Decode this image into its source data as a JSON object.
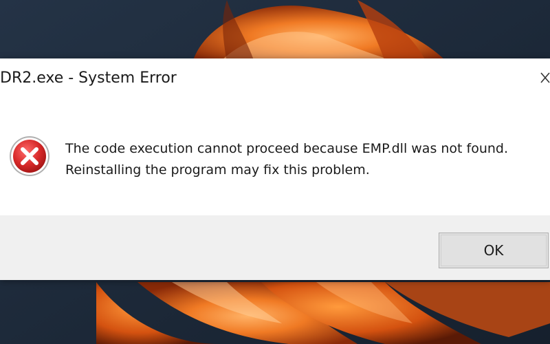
{
  "dialog": {
    "title": "DR2.exe - System Error",
    "message_line1": "The code execution cannot proceed because EMP.dll was not found.",
    "message_line2": "Reinstalling the program may fix this problem.",
    "ok_label": "OK",
    "icon": "error-icon",
    "close_icon": "close-icon"
  },
  "colors": {
    "error_red": "#d32f2f",
    "footer_bg": "#f0f0f0",
    "button_bg": "#e1e1e1",
    "wallpaper_dark": "#1f2a3a",
    "wallpaper_orange": "#e8651c"
  }
}
